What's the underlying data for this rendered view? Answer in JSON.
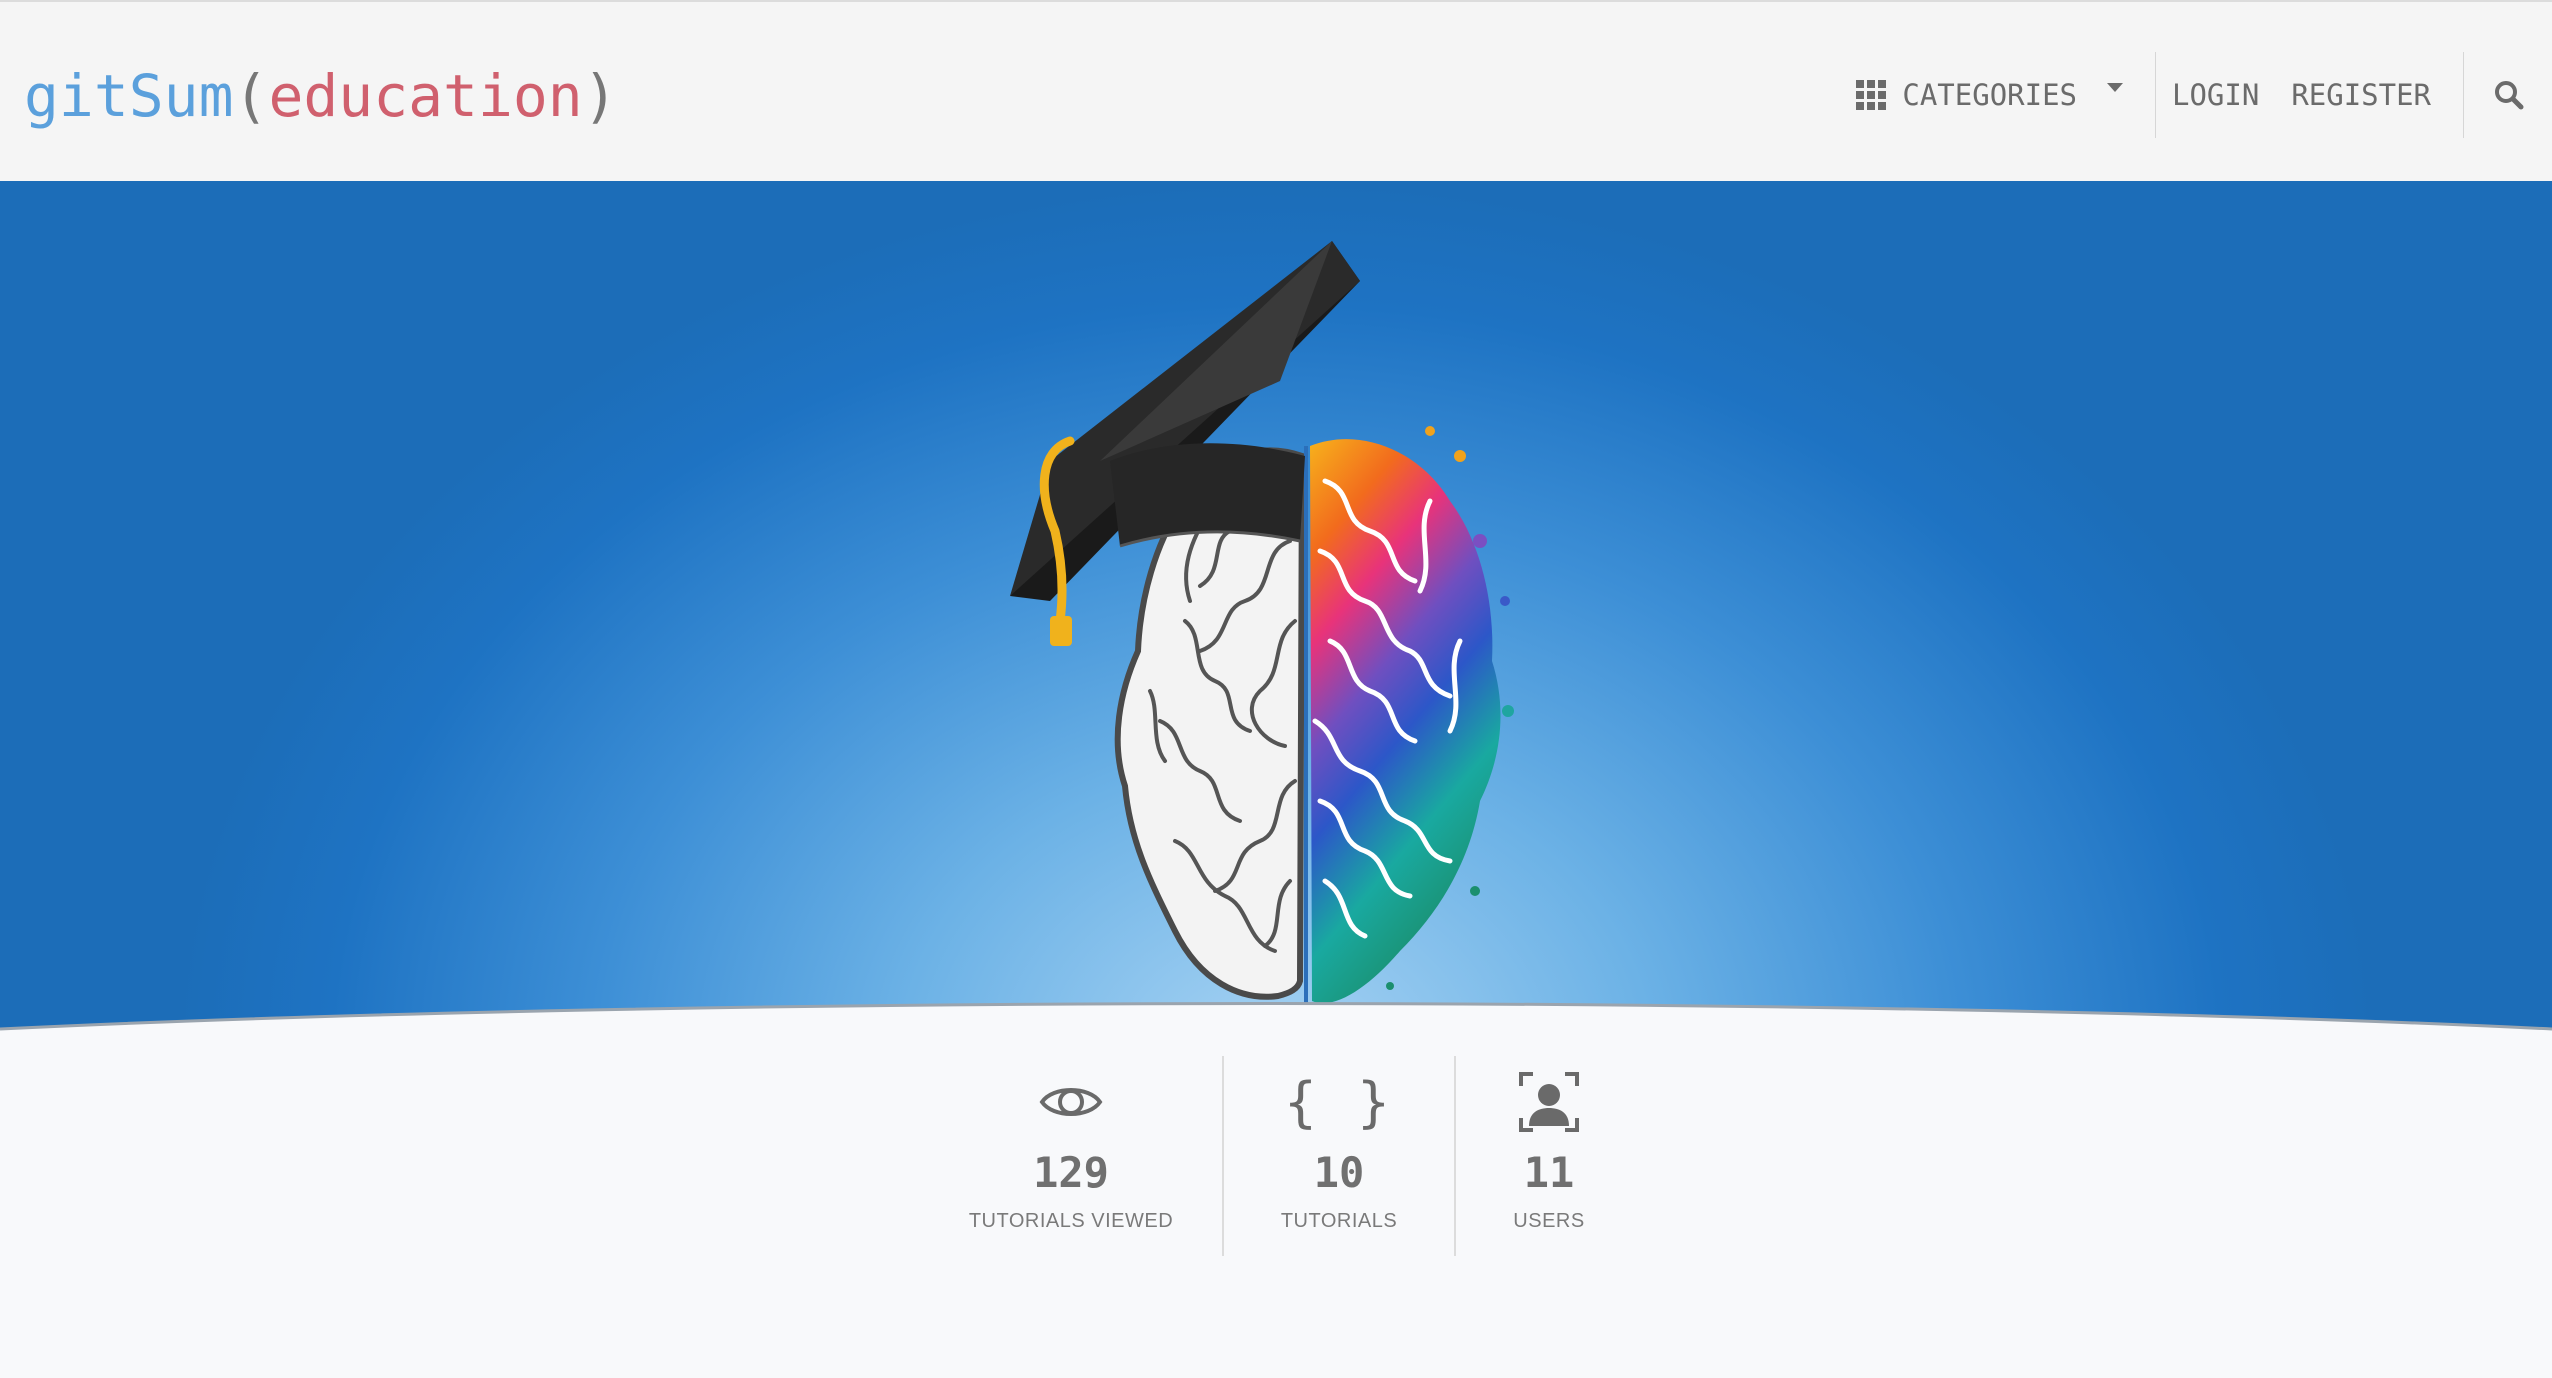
{
  "navbar": {
    "brand_name": "gitSum",
    "brand_paren_open": "(",
    "brand_sub": "education",
    "brand_paren_close": ")",
    "categories_label": "CATEGORIES",
    "login_label": "LOGIN",
    "register_label": "REGISTER",
    "search_icon": "search-icon"
  },
  "hero": {
    "image": "graduation-cap-brain-illustration"
  },
  "stats": [
    {
      "icon": "eye-icon",
      "value": "129",
      "label": "TUTORIALS VIEWED"
    },
    {
      "icon": "braces-icon",
      "icon_text": "{ }",
      "value": "10",
      "label": "TUTORIALS"
    },
    {
      "icon": "user-icon",
      "value": "11",
      "label": "USERS"
    }
  ],
  "colors": {
    "brand_blue": "#5ba0dc",
    "brand_red": "#d0606e",
    "hero_blue": "#1e73c3",
    "hero_light": "#a7d3f3"
  }
}
